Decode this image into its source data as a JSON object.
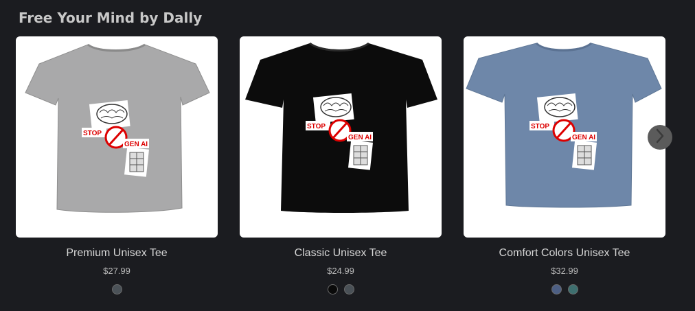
{
  "section": {
    "title": "Free Your Mind by Dally"
  },
  "design": {
    "stop_text": "STOP",
    "gen_ai_text": "GEN AI"
  },
  "products": [
    {
      "name": "Premium Unisex Tee",
      "price": "$27.99",
      "shirt_color": "#a9a9aa",
      "swatches": [
        "#4b5258"
      ]
    },
    {
      "name": "Classic Unisex Tee",
      "price": "$24.99",
      "shirt_color": "#0c0c0c",
      "swatches": [
        "#0a0a0a",
        "#4a5157"
      ]
    },
    {
      "name": "Comfort Colors Unisex Tee",
      "price": "$32.99",
      "shirt_color": "#6e87a9",
      "swatches": [
        "#4d5f84",
        "#3e6f6f"
      ]
    }
  ],
  "carousel": {
    "next_icon": "chevron-right-icon"
  }
}
